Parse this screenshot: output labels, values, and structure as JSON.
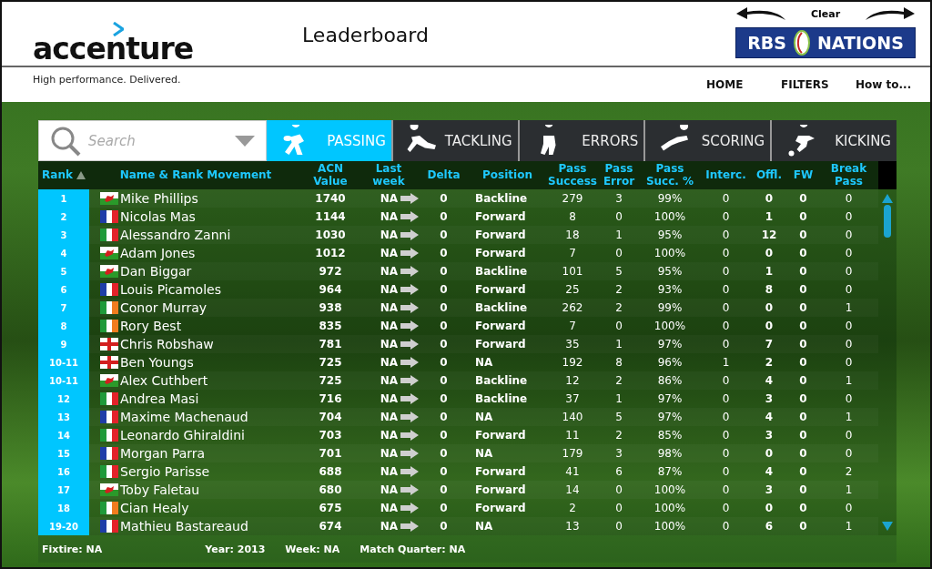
{
  "header": {
    "logo": "accenture",
    "tagline": "High performance. Delivered.",
    "title": "Leaderboard",
    "clear": "Clear",
    "sponsor_logo": {
      "left": "RBS",
      "right": "NATIONS"
    },
    "nav": [
      "HOME",
      "FILTERS",
      "How to..."
    ]
  },
  "search": {
    "placeholder": "Search"
  },
  "tabs": [
    {
      "label": "PASSING",
      "selected": true
    },
    {
      "label": "TACKLING",
      "selected": false
    },
    {
      "label": "ERRORS",
      "selected": false
    },
    {
      "label": "SCORING",
      "selected": false
    },
    {
      "label": "KICKING",
      "selected": false
    }
  ],
  "table": {
    "columns": [
      "Rank",
      "Name & Rank Movement",
      "ACN Value",
      "Last week",
      "Delta",
      "Position",
      "Pass Success",
      "Pass Error",
      "Pass Succ. %",
      "Interc.",
      "Offl.",
      "FW",
      "Break Pass"
    ],
    "rows": [
      {
        "rank": "1",
        "flag": {
          "kind": "wales"
        },
        "name": "Mike Phillips",
        "acn_value": "1740",
        "last_week": "NA",
        "delta": "0",
        "position": "Backline",
        "pass_success": "279",
        "pass_error": "3",
        "pass_succ_pct": "99%",
        "interc": "0",
        "offl": "0",
        "fw": "0",
        "break_pass": "0"
      },
      {
        "rank": "2",
        "flag": {
          "kind": "france"
        },
        "name": "Nicolas Mas",
        "acn_value": "1144",
        "last_week": "NA",
        "delta": "0",
        "position": "Forward",
        "pass_success": "8",
        "pass_error": "0",
        "pass_succ_pct": "100%",
        "interc": "0",
        "offl": "1",
        "fw": "0",
        "break_pass": "0"
      },
      {
        "rank": "3",
        "flag": {
          "kind": "italy"
        },
        "name": "Alessandro Zanni",
        "acn_value": "1030",
        "last_week": "NA",
        "delta": "0",
        "position": "Forward",
        "pass_success": "18",
        "pass_error": "1",
        "pass_succ_pct": "95%",
        "interc": "0",
        "offl": "12",
        "fw": "0",
        "break_pass": "0"
      },
      {
        "rank": "4",
        "flag": {
          "kind": "wales"
        },
        "name": "Adam Jones",
        "acn_value": "1012",
        "last_week": "NA",
        "delta": "0",
        "position": "Forward",
        "pass_success": "7",
        "pass_error": "0",
        "pass_succ_pct": "100%",
        "interc": "0",
        "offl": "0",
        "fw": "0",
        "break_pass": "0"
      },
      {
        "rank": "5",
        "flag": {
          "kind": "wales"
        },
        "name": "Dan Biggar",
        "acn_value": "972",
        "last_week": "NA",
        "delta": "0",
        "position": "Backline",
        "pass_success": "101",
        "pass_error": "5",
        "pass_succ_pct": "95%",
        "interc": "0",
        "offl": "1",
        "fw": "0",
        "break_pass": "0"
      },
      {
        "rank": "6",
        "flag": {
          "kind": "france"
        },
        "name": "Louis Picamoles",
        "acn_value": "964",
        "last_week": "NA",
        "delta": "0",
        "position": "Forward",
        "pass_success": "25",
        "pass_error": "2",
        "pass_succ_pct": "93%",
        "interc": "0",
        "offl": "8",
        "fw": "0",
        "break_pass": "0"
      },
      {
        "rank": "7",
        "flag": {
          "kind": "ireland"
        },
        "name": "Conor Murray",
        "acn_value": "938",
        "last_week": "NA",
        "delta": "0",
        "position": "Backline",
        "pass_success": "262",
        "pass_error": "2",
        "pass_succ_pct": "99%",
        "interc": "0",
        "offl": "0",
        "fw": "0",
        "break_pass": "1"
      },
      {
        "rank": "8",
        "flag": {
          "kind": "ireland"
        },
        "name": "Rory Best",
        "acn_value": "835",
        "last_week": "NA",
        "delta": "0",
        "position": "Forward",
        "pass_success": "7",
        "pass_error": "0",
        "pass_succ_pct": "100%",
        "interc": "0",
        "offl": "0",
        "fw": "0",
        "break_pass": "0"
      },
      {
        "rank": "9",
        "flag": {
          "kind": "england"
        },
        "name": "Chris Robshaw",
        "acn_value": "781",
        "last_week": "NA",
        "delta": "0",
        "position": "Forward",
        "pass_success": "35",
        "pass_error": "1",
        "pass_succ_pct": "97%",
        "interc": "0",
        "offl": "7",
        "fw": "0",
        "break_pass": "0"
      },
      {
        "rank": "10-11",
        "flag": {
          "kind": "england"
        },
        "name": "Ben Youngs",
        "acn_value": "725",
        "last_week": "NA",
        "delta": "0",
        "position": "NA",
        "pass_success": "192",
        "pass_error": "8",
        "pass_succ_pct": "96%",
        "interc": "1",
        "offl": "2",
        "fw": "0",
        "break_pass": "0"
      },
      {
        "rank": "10-11",
        "flag": {
          "kind": "wales"
        },
        "name": "Alex Cuthbert",
        "acn_value": "725",
        "last_week": "NA",
        "delta": "0",
        "position": "Backline",
        "pass_success": "12",
        "pass_error": "2",
        "pass_succ_pct": "86%",
        "interc": "0",
        "offl": "4",
        "fw": "0",
        "break_pass": "1"
      },
      {
        "rank": "12",
        "flag": {
          "kind": "italy"
        },
        "name": "Andrea Masi",
        "acn_value": "716",
        "last_week": "NA",
        "delta": "0",
        "position": "Backline",
        "pass_success": "37",
        "pass_error": "1",
        "pass_succ_pct": "97%",
        "interc": "0",
        "offl": "3",
        "fw": "0",
        "break_pass": "0"
      },
      {
        "rank": "13",
        "flag": {
          "kind": "france"
        },
        "name": "Maxime Machenaud",
        "acn_value": "704",
        "last_week": "NA",
        "delta": "0",
        "position": "NA",
        "pass_success": "140",
        "pass_error": "5",
        "pass_succ_pct": "97%",
        "interc": "0",
        "offl": "4",
        "fw": "0",
        "break_pass": "1"
      },
      {
        "rank": "14",
        "flag": {
          "kind": "italy"
        },
        "name": "Leonardo Ghiraldini",
        "acn_value": "703",
        "last_week": "NA",
        "delta": "0",
        "position": "Forward",
        "pass_success": "11",
        "pass_error": "2",
        "pass_succ_pct": "85%",
        "interc": "0",
        "offl": "3",
        "fw": "0",
        "break_pass": "0"
      },
      {
        "rank": "15",
        "flag": {
          "kind": "france"
        },
        "name": "Morgan Parra",
        "acn_value": "701",
        "last_week": "NA",
        "delta": "0",
        "position": "NA",
        "pass_success": "179",
        "pass_error": "3",
        "pass_succ_pct": "98%",
        "interc": "0",
        "offl": "0",
        "fw": "0",
        "break_pass": "0"
      },
      {
        "rank": "16",
        "flag": {
          "kind": "italy"
        },
        "name": "Sergio Parisse",
        "acn_value": "688",
        "last_week": "NA",
        "delta": "0",
        "position": "Forward",
        "pass_success": "41",
        "pass_error": "6",
        "pass_succ_pct": "87%",
        "interc": "0",
        "offl": "4",
        "fw": "0",
        "break_pass": "2"
      },
      {
        "rank": "17",
        "flag": {
          "kind": "wales"
        },
        "name": "Toby Faletau",
        "acn_value": "680",
        "last_week": "NA",
        "delta": "0",
        "position": "Forward",
        "pass_success": "14",
        "pass_error": "0",
        "pass_succ_pct": "100%",
        "interc": "0",
        "offl": "3",
        "fw": "0",
        "break_pass": "1"
      },
      {
        "rank": "18",
        "flag": {
          "kind": "ireland"
        },
        "name": "Cian Healy",
        "acn_value": "675",
        "last_week": "NA",
        "delta": "0",
        "position": "Forward",
        "pass_success": "2",
        "pass_error": "0",
        "pass_succ_pct": "100%",
        "interc": "0",
        "offl": "0",
        "fw": "0",
        "break_pass": "0"
      },
      {
        "rank": "19-20",
        "flag": {
          "kind": "france"
        },
        "name": "Mathieu Bastareaud",
        "acn_value": "674",
        "last_week": "NA",
        "delta": "0",
        "position": "NA",
        "pass_success": "13",
        "pass_error": "0",
        "pass_succ_pct": "100%",
        "interc": "0",
        "offl": "6",
        "fw": "0",
        "break_pass": "1"
      }
    ]
  },
  "footer": {
    "fixture": "Fixtire: NA",
    "year": "Year: 2013",
    "week": "Week: NA",
    "match_quarter": "Match Quarter: NA"
  }
}
